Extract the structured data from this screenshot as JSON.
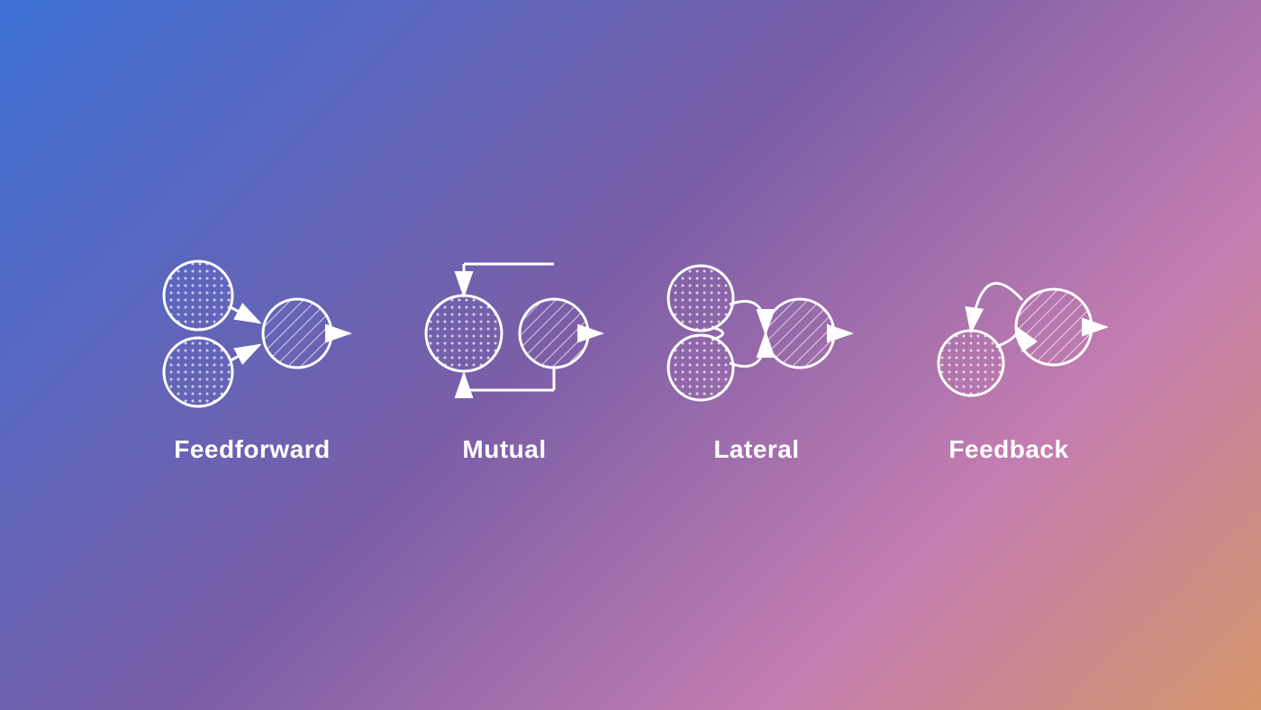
{
  "background": {
    "gradient_start": "#3b6fd4",
    "gradient_end": "#d4956a"
  },
  "diagrams": [
    {
      "id": "feedforward",
      "label": "Feedforward"
    },
    {
      "id": "mutual",
      "label": "Mutual"
    },
    {
      "id": "lateral",
      "label": "Lateral"
    },
    {
      "id": "feedback",
      "label": "Feedback"
    }
  ]
}
